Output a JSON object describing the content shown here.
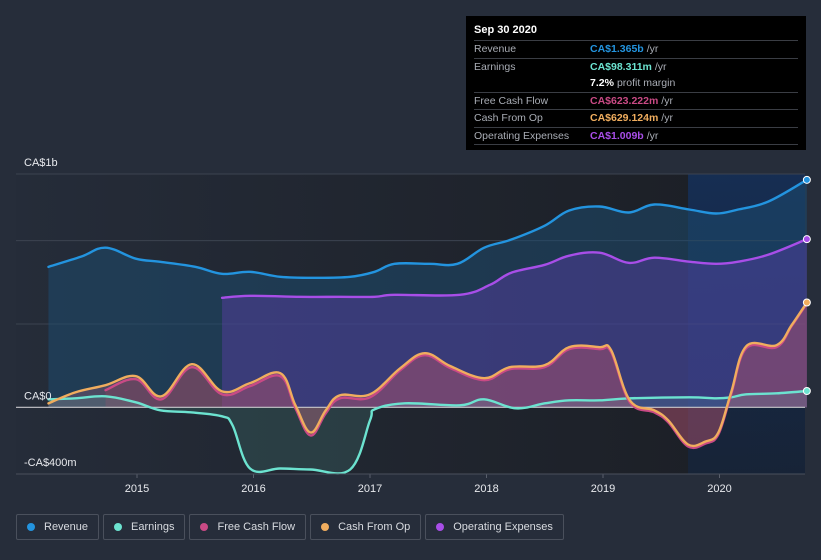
{
  "tooltip": {
    "date": "Sep 30 2020",
    "rows": [
      {
        "label": "Revenue",
        "value": "CA$1.365b",
        "unit": "/yr",
        "color": "#2394df"
      },
      {
        "label": "Earnings",
        "value": "CA$98.311m",
        "unit": "/yr",
        "color": "#6ce3d0"
      },
      {
        "label": "",
        "value": "7.2%",
        "unit": "profit margin",
        "color": "#ffffff"
      },
      {
        "label": "Free Cash Flow",
        "value": "CA$623.222m",
        "unit": "/yr",
        "color": "#c94a85"
      },
      {
        "label": "Cash From Op",
        "value": "CA$629.124m",
        "unit": "/yr",
        "color": "#f0ad5e"
      },
      {
        "label": "Operating Expenses",
        "value": "CA$1.009b",
        "unit": "/yr",
        "color": "#a84ee8"
      }
    ]
  },
  "legend": [
    {
      "label": "Revenue",
      "color": "#2394df"
    },
    {
      "label": "Earnings",
      "color": "#6ce3d0"
    },
    {
      "label": "Free Cash Flow",
      "color": "#c94a85"
    },
    {
      "label": "Cash From Op",
      "color": "#f0ad5e"
    },
    {
      "label": "Operating Expenses",
      "color": "#a84ee8"
    }
  ],
  "chart_data": {
    "type": "area",
    "title": "",
    "xlabel": "",
    "ylabel": "",
    "y_unit": "CA$m",
    "ylim": [
      -400,
      1400
    ],
    "xlim": [
      2014.24,
      2020.75
    ],
    "y_tick_labels": [
      {
        "value": 1400,
        "label": "CA$1b"
      },
      {
        "value": 0,
        "label": "CA$0"
      },
      {
        "value": -400,
        "label": "-CA$400m"
      }
    ],
    "gridlines": [
      1400,
      1000,
      500,
      0,
      -400
    ],
    "x_ticks": [
      {
        "value": 2015,
        "label": "2015"
      },
      {
        "value": 2016,
        "label": "2016"
      },
      {
        "value": 2017,
        "label": "2017"
      },
      {
        "value": 2018,
        "label": "2018"
      },
      {
        "value": 2019,
        "label": "2019"
      },
      {
        "value": 2020,
        "label": "2020"
      }
    ],
    "highlight_range": [
      2019.73,
      2020.75
    ],
    "series": [
      {
        "name": "Revenue",
        "key": "revenue",
        "color": "#2394df",
        "points": [
          [
            2014.24,
            843
          ],
          [
            2014.52,
            904
          ],
          [
            2014.73,
            958
          ],
          [
            2014.99,
            892
          ],
          [
            2015.2,
            873
          ],
          [
            2015.5,
            843
          ],
          [
            2015.73,
            801
          ],
          [
            2015.97,
            813
          ],
          [
            2016.23,
            783
          ],
          [
            2016.53,
            777
          ],
          [
            2016.83,
            783
          ],
          [
            2017.04,
            813
          ],
          [
            2017.21,
            861
          ],
          [
            2017.51,
            861
          ],
          [
            2017.75,
            861
          ],
          [
            2017.98,
            958
          ],
          [
            2018.21,
            1006
          ],
          [
            2018.5,
            1090
          ],
          [
            2018.71,
            1181
          ],
          [
            2018.97,
            1205
          ],
          [
            2019.22,
            1169
          ],
          [
            2019.44,
            1217
          ],
          [
            2019.74,
            1187
          ],
          [
            2019.97,
            1163
          ],
          [
            2020.16,
            1187
          ],
          [
            2020.42,
            1235
          ],
          [
            2020.75,
            1365
          ]
        ]
      },
      {
        "name": "Operating Expenses",
        "key": "opex",
        "color": "#a84ee8",
        "points": [
          [
            2015.73,
            657
          ],
          [
            2015.97,
            669
          ],
          [
            2016.4,
            663
          ],
          [
            2016.74,
            663
          ],
          [
            2017.04,
            663
          ],
          [
            2017.21,
            675
          ],
          [
            2017.77,
            675
          ],
          [
            2018.03,
            735
          ],
          [
            2018.21,
            807
          ],
          [
            2018.5,
            855
          ],
          [
            2018.71,
            910
          ],
          [
            2018.97,
            928
          ],
          [
            2019.22,
            867
          ],
          [
            2019.44,
            898
          ],
          [
            2019.74,
            874
          ],
          [
            2019.97,
            861
          ],
          [
            2020.16,
            874
          ],
          [
            2020.42,
            916
          ],
          [
            2020.75,
            1009
          ]
        ]
      },
      {
        "name": "Cash From Op",
        "key": "cfo",
        "color": "#f0ad5e",
        "points": [
          [
            2014.24,
            24
          ],
          [
            2014.47,
            90
          ],
          [
            2014.73,
            133
          ],
          [
            2014.99,
            187
          ],
          [
            2015.21,
            66
          ],
          [
            2015.47,
            259
          ],
          [
            2015.73,
            96
          ],
          [
            2015.97,
            145
          ],
          [
            2016.23,
            205
          ],
          [
            2016.36,
            12
          ],
          [
            2016.49,
            -151
          ],
          [
            2016.62,
            -18
          ],
          [
            2016.74,
            72
          ],
          [
            2017.0,
            78
          ],
          [
            2017.26,
            235
          ],
          [
            2017.47,
            325
          ],
          [
            2017.69,
            247
          ],
          [
            2017.98,
            175
          ],
          [
            2018.2,
            241
          ],
          [
            2018.5,
            253
          ],
          [
            2018.71,
            361
          ],
          [
            2018.97,
            361
          ],
          [
            2019.07,
            343
          ],
          [
            2019.23,
            42
          ],
          [
            2019.44,
            -18
          ],
          [
            2019.56,
            -78
          ],
          [
            2019.73,
            -223
          ],
          [
            2019.88,
            -205
          ],
          [
            2019.99,
            -151
          ],
          [
            2020.1,
            90
          ],
          [
            2020.23,
            367
          ],
          [
            2020.49,
            373
          ],
          [
            2020.62,
            494
          ],
          [
            2020.75,
            629
          ]
        ]
      },
      {
        "name": "Free Cash Flow",
        "key": "fcf",
        "color": "#c94a85",
        "points": [
          [
            2014.73,
            103
          ],
          [
            2014.99,
            169
          ],
          [
            2015.21,
            48
          ],
          [
            2015.47,
            241
          ],
          [
            2015.73,
            78
          ],
          [
            2015.97,
            127
          ],
          [
            2016.23,
            187
          ],
          [
            2016.36,
            -6
          ],
          [
            2016.49,
            -169
          ],
          [
            2016.62,
            -36
          ],
          [
            2016.74,
            54
          ],
          [
            2017.0,
            60
          ],
          [
            2017.26,
            223
          ],
          [
            2017.47,
            313
          ],
          [
            2017.69,
            235
          ],
          [
            2017.98,
            163
          ],
          [
            2018.2,
            229
          ],
          [
            2018.5,
            241
          ],
          [
            2018.71,
            349
          ],
          [
            2018.97,
            349
          ],
          [
            2019.07,
            331
          ],
          [
            2019.23,
            30
          ],
          [
            2019.44,
            -30
          ],
          [
            2019.56,
            -90
          ],
          [
            2019.73,
            -235
          ],
          [
            2019.88,
            -217
          ],
          [
            2019.99,
            -163
          ],
          [
            2020.1,
            78
          ],
          [
            2020.23,
            355
          ],
          [
            2020.49,
            361
          ],
          [
            2020.62,
            488
          ],
          [
            2020.75,
            623
          ]
        ]
      },
      {
        "name": "Earnings",
        "key": "earnings",
        "color": "#6ce3d0",
        "points": [
          [
            2014.24,
            48
          ],
          [
            2014.47,
            54
          ],
          [
            2014.73,
            66
          ],
          [
            2014.99,
            30
          ],
          [
            2015.2,
            -18
          ],
          [
            2015.46,
            -30
          ],
          [
            2015.73,
            -54
          ],
          [
            2015.82,
            -108
          ],
          [
            2015.97,
            -367
          ],
          [
            2016.23,
            -367
          ],
          [
            2016.49,
            -373
          ],
          [
            2016.83,
            -373
          ],
          [
            2017.0,
            -78
          ],
          [
            2017.04,
            -12
          ],
          [
            2017.3,
            24
          ],
          [
            2017.77,
            12
          ],
          [
            2017.98,
            48
          ],
          [
            2018.25,
            -6
          ],
          [
            2018.5,
            24
          ],
          [
            2018.71,
            42
          ],
          [
            2018.97,
            42
          ],
          [
            2019.23,
            54
          ],
          [
            2019.74,
            60
          ],
          [
            2019.97,
            54
          ],
          [
            2020.1,
            60
          ],
          [
            2020.23,
            78
          ],
          [
            2020.49,
            84
          ],
          [
            2020.75,
            98
          ]
        ]
      }
    ]
  }
}
